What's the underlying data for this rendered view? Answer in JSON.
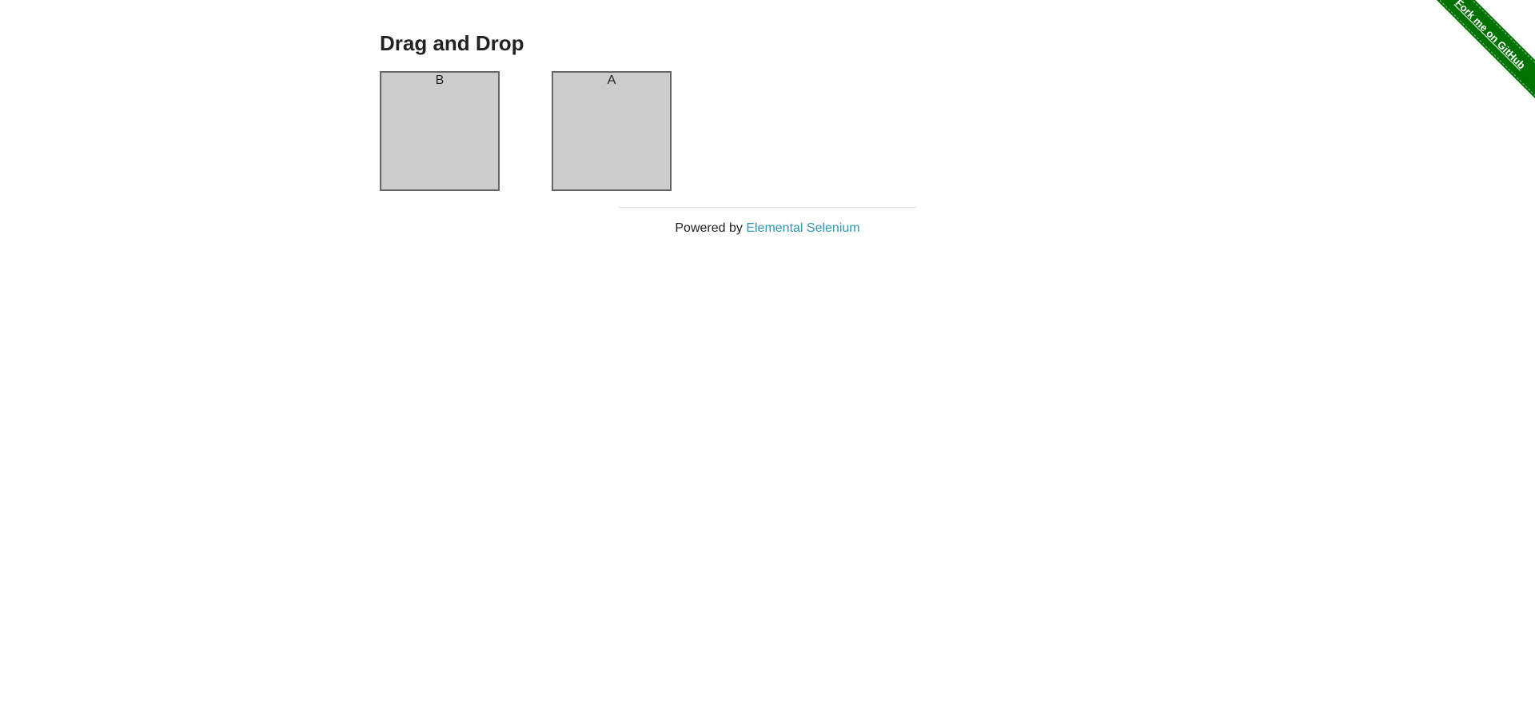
{
  "page": {
    "title": "Drag and Drop"
  },
  "columns": [
    {
      "header": "B"
    },
    {
      "header": "A"
    }
  ],
  "footer": {
    "prefix": "Powered by ",
    "link_text": "Elemental Selenium"
  },
  "ribbon": {
    "text": "Fork me on GitHub",
    "color": "#007200"
  },
  "colors": {
    "box_fill": "#cccccc",
    "box_border": "#666666",
    "link": "#2a9ab8"
  }
}
